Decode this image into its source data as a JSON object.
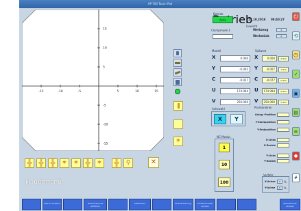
{
  "window": {
    "title": "AP-700 Touch Pad"
  },
  "status": {
    "betrieb_label": "Betrieb",
    "mode": "Aktiv",
    "date": "17.10.2019",
    "time": "08:40:27",
    "clampmode_label": "Clampmode 1",
    "gewicht_label": "Gewicht",
    "werkzeug_label": "Werkzeug",
    "werkzeug_value": "0",
    "werkstueck_label": "Werkstück",
    "werkstueck_value": "0"
  },
  "plot": {
    "x_ticks": [
      "-15",
      "-10",
      "-5",
      "5",
      "10",
      "15"
    ],
    "y_ticks": [
      "15",
      "10",
      "5",
      "-5",
      "-10",
      "-15"
    ]
  },
  "ist": {
    "header": "Modell",
    "rows": [
      {
        "axis": "X",
        "value": "0.000"
      },
      {
        "axis": "Y",
        "value": "-0.002"
      },
      {
        "axis": "C",
        "value": "-0.027"
      },
      {
        "axis": "U",
        "value": "174.994"
      },
      {
        "axis": "V",
        "value": "250.000"
      }
    ]
  },
  "soll": {
    "header": "Sollwert",
    "rows": [
      {
        "axis": "X",
        "value": "0.000",
        "unit": "X Null"
      },
      {
        "axis": "Y",
        "value": "-0.007",
        "unit": "Y Null"
      },
      {
        "axis": "C",
        "value": "-0.077",
        "unit": "C Null"
      },
      {
        "axis": "U",
        "value": "174.994",
        "unit": "U Null"
      },
      {
        "axis": "V",
        "value": "250.000",
        "unit": "V Null"
      }
    ]
  },
  "achswahl": {
    "header": "Achswahl",
    "x": "X",
    "y": "Y"
  },
  "nc_mode": {
    "header": "NC-Modus",
    "values": [
      "1",
      "10",
      "100"
    ]
  },
  "positions": {
    "header": "Positionieren",
    "items": [
      "Anlag.-Position",
      "Y-Startposition",
      "Y-Endposition",
      "X-Links",
      "X-Rechts",
      "Y-Links",
      "Y-Rechts"
    ]
  },
  "verfahr": {
    "header": "Verfahr",
    "x_label": "X-Achse",
    "x_value": "0",
    "y_label": "Y-Achse",
    "y_value": "0",
    "unit": "%"
  },
  "hauptmenu": "Hauptmenü",
  "bottom_buttons": [
    "",
    "Satz an Position",
    "",
    "Referenzpunkt anfahren",
    "",
    "Kalibrieren",
    "",
    "Drahtzuführung",
    "Drahtschneider ein/aus",
    "",
    "",
    "Späneschutz ein/aus"
  ]
}
